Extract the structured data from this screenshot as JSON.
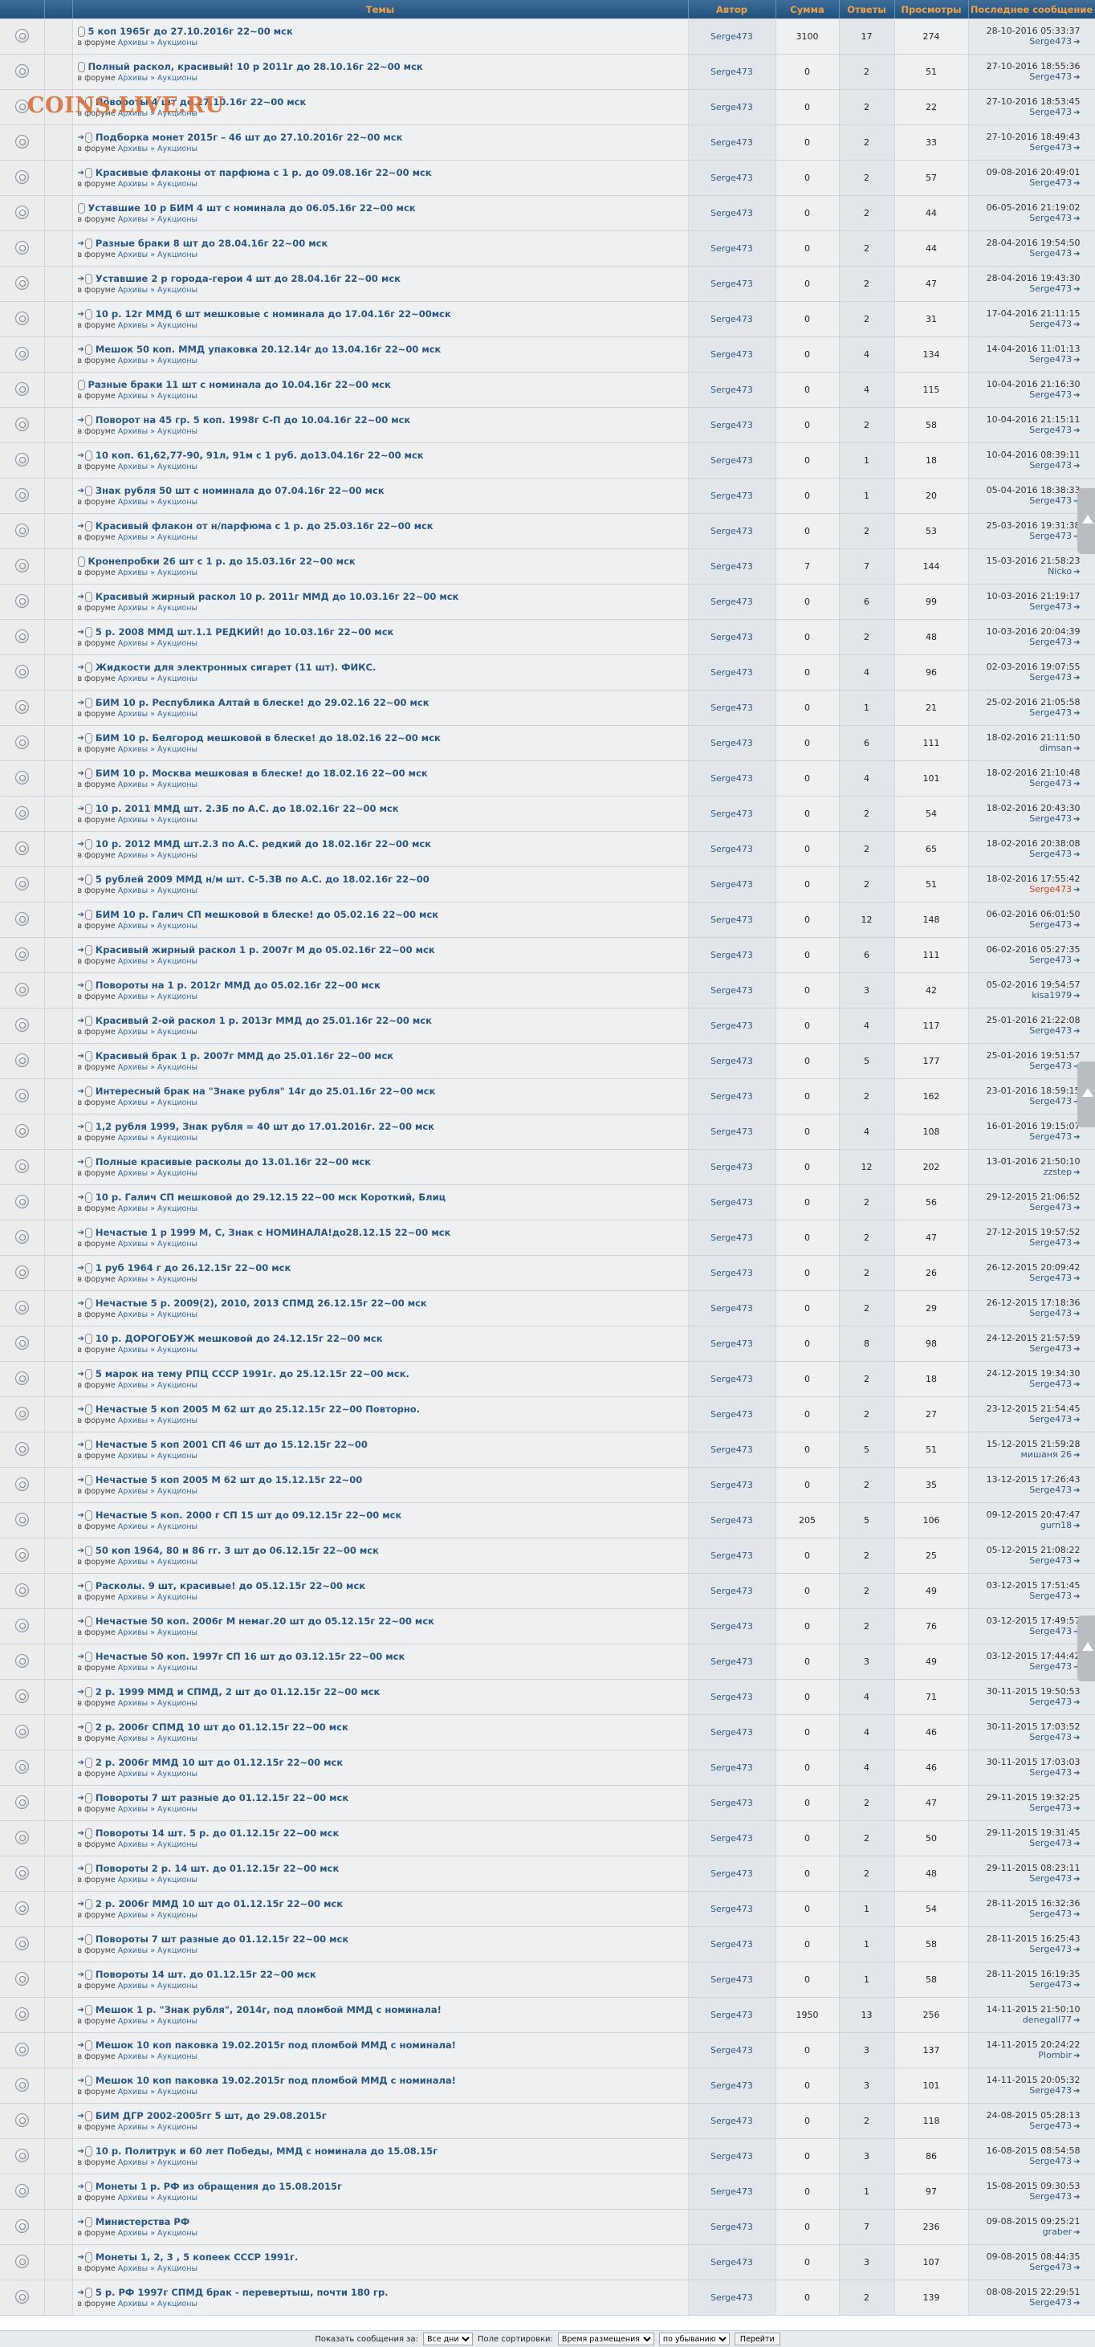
{
  "headers": {
    "topics": "Темы",
    "author": "Автор",
    "sum": "Сумма",
    "replies": "Ответы",
    "views": "Просмотры",
    "last": "Последнее сообщение"
  },
  "watermark": "COINS.LIVE.RU",
  "forum_prefix": "в форуме",
  "forum_link": "Архивы » Аукционы",
  "rows": [
    {
      "title": "5 коп 1965г до 27.10.2016г 22~00 мск",
      "author": "Serge473",
      "sum": "3100",
      "replies": "17",
      "views": "274",
      "date": "28-10-2016 05:33:37",
      "user": "Serge473",
      "newmark": false
    },
    {
      "title": "Полный раскол, красивый! 10 р 2011г до 28.10.16г 22~00 мск",
      "author": "Serge473",
      "sum": "0",
      "replies": "2",
      "views": "51",
      "date": "27-10-2016 18:55:36",
      "user": "Serge473",
      "newmark": false
    },
    {
      "title": "Повороты 4 шт до 27.10.16г 22~00 мск",
      "author": "Serge473",
      "sum": "0",
      "replies": "2",
      "views": "22",
      "date": "27-10-2016 18:53:45",
      "user": "Serge473",
      "newmark": true
    },
    {
      "title": "Подборка монет 2015г – 46 шт до 27.10.2016г 22~00 мск",
      "author": "Serge473",
      "sum": "0",
      "replies": "2",
      "views": "33",
      "date": "27-10-2016 18:49:43",
      "user": "Serge473",
      "newmark": true
    },
    {
      "title": "Красивые флаконы от парфюма с 1 р. до 09.08.16г 22~00 мск",
      "author": "Serge473",
      "sum": "0",
      "replies": "2",
      "views": "57",
      "date": "09-08-2016 20:49:01",
      "user": "Serge473",
      "newmark": true
    },
    {
      "title": "Уставшие 10 р БИМ 4 шт с номинала до 06.05.16г 22~00 мск",
      "author": "Serge473",
      "sum": "0",
      "replies": "2",
      "views": "44",
      "date": "06-05-2016 21:19:02",
      "user": "Serge473",
      "newmark": false
    },
    {
      "title": "Разные браки 8 шт до 28.04.16г 22~00 мск",
      "author": "Serge473",
      "sum": "0",
      "replies": "2",
      "views": "44",
      "date": "28-04-2016 19:54:50",
      "user": "Serge473",
      "newmark": true
    },
    {
      "title": "Уставшие 2 р города-герои 4 шт до 28.04.16г 22~00 мск",
      "author": "Serge473",
      "sum": "0",
      "replies": "2",
      "views": "47",
      "date": "28-04-2016 19:43:30",
      "user": "Serge473",
      "newmark": true
    },
    {
      "title": "10 р. 12г ММД 6 шт мешковые с номинала до 17.04.16г 22~00мск",
      "author": "Serge473",
      "sum": "0",
      "replies": "2",
      "views": "31",
      "date": "17-04-2016 21:11:15",
      "user": "Serge473",
      "newmark": true
    },
    {
      "title": "Мешок 50 коп. ММД упаковка 20.12.14г до 13.04.16г 22~00 мск",
      "author": "Serge473",
      "sum": "0",
      "replies": "4",
      "views": "134",
      "date": "14-04-2016 11:01:13",
      "user": "Serge473",
      "newmark": true
    },
    {
      "title": "Разные браки 11 шт с номинала до 10.04.16г 22~00 мск",
      "author": "Serge473",
      "sum": "0",
      "replies": "4",
      "views": "115",
      "date": "10-04-2016 21:16:30",
      "user": "Serge473",
      "newmark": false
    },
    {
      "title": "Поворот на 45 гр. 5 коп. 1998г С-П до 10.04.16г 22~00 мск",
      "author": "Serge473",
      "sum": "0",
      "replies": "2",
      "views": "58",
      "date": "10-04-2016 21:15:11",
      "user": "Serge473",
      "newmark": true
    },
    {
      "title": "10 коп. 61,62,77-90, 91л, 91м с 1 руб. до13.04.16г 22~00 мск",
      "author": "Serge473",
      "sum": "0",
      "replies": "1",
      "views": "18",
      "date": "10-04-2016 08:39:11",
      "user": "Serge473",
      "newmark": true
    },
    {
      "title": "Знак рубля 50 шт с номинала до 07.04.16г 22~00 мск",
      "author": "Serge473",
      "sum": "0",
      "replies": "1",
      "views": "20",
      "date": "05-04-2016 18:38:33",
      "user": "Serge473",
      "newmark": true
    },
    {
      "title": "Красивый флакон от н/парфюма с 1 р. до 25.03.16г 22~00 мск",
      "author": "Serge473",
      "sum": "0",
      "replies": "2",
      "views": "53",
      "date": "25-03-2016 19:31:38",
      "user": "Serge473",
      "newmark": true
    },
    {
      "title": "Кронепробки 26 шт с 1 р. до 15.03.16г 22~00 мск",
      "author": "Serge473",
      "sum": "7",
      "replies": "7",
      "views": "144",
      "date": "15-03-2016 21:58:23",
      "user": "Nicko",
      "newmark": false
    },
    {
      "title": "Красивый жирный раскол 10 р. 2011г ММД до 10.03.16г 22~00 мск",
      "author": "Serge473",
      "sum": "0",
      "replies": "6",
      "views": "99",
      "date": "10-03-2016 21:19:17",
      "user": "Serge473",
      "newmark": true
    },
    {
      "title": "5 р. 2008 ММД шт.1.1 РЕДКИЙ! до 10.03.16г 22~00 мск",
      "author": "Serge473",
      "sum": "0",
      "replies": "2",
      "views": "48",
      "date": "10-03-2016 20:04:39",
      "user": "Serge473",
      "newmark": true
    },
    {
      "title": "Жидкости для электронных сигарет (11 шт). ФИКС.",
      "author": "Serge473",
      "sum": "0",
      "replies": "4",
      "views": "96",
      "date": "02-03-2016 19:07:55",
      "user": "Serge473",
      "newmark": true
    },
    {
      "title": "БИМ 10 р. Республика Алтай в блеске! до 29.02.16 22~00 мск",
      "author": "Serge473",
      "sum": "0",
      "replies": "1",
      "views": "21",
      "date": "25-02-2016 21:05:58",
      "user": "Serge473",
      "newmark": true
    },
    {
      "title": "БИМ 10 р. Белгород мешковой в блеске! до 18.02.16 22~00 мск",
      "author": "Serge473",
      "sum": "0",
      "replies": "6",
      "views": "111",
      "date": "18-02-2016 21:11:50",
      "user": "dimsan",
      "newmark": true
    },
    {
      "title": "БИМ 10 р. Москва мешковая в блеске! до 18.02.16 22~00 мск",
      "author": "Serge473",
      "sum": "0",
      "replies": "4",
      "views": "101",
      "date": "18-02-2016 21:10:48",
      "user": "Serge473",
      "newmark": true
    },
    {
      "title": "10 р. 2011 ММД шт. 2.3Б по А.С. до 18.02.16г 22~00 мск",
      "author": "Serge473",
      "sum": "0",
      "replies": "2",
      "views": "54",
      "date": "18-02-2016 20:43:30",
      "user": "Serge473",
      "newmark": true
    },
    {
      "title": "10 р. 2012 ММД шт.2.3 по А.С. редкий до 18.02.16г 22~00 мск",
      "author": "Serge473",
      "sum": "0",
      "replies": "2",
      "views": "65",
      "date": "18-02-2016 20:38:08",
      "user": "Serge473",
      "newmark": true
    },
    {
      "title": "5 рублей 2009 ММД н/м шт. С-5.3В по А.С. до 18.02.16г 22~00",
      "author": "Serge473",
      "sum": "0",
      "replies": "2",
      "views": "51",
      "date": "18-02-2016 17:55:42",
      "user": "Serge473",
      "userRed": true,
      "newmark": true
    },
    {
      "title": "БИМ 10 р. Галич СП мешковой в блеске! до 05.02.16 22~00 мск",
      "author": "Serge473",
      "sum": "0",
      "replies": "12",
      "views": "148",
      "date": "06-02-2016 06:01:50",
      "user": "Serge473",
      "newmark": true
    },
    {
      "title": "Красивый жирный раскол 1 р. 2007г М до 05.02.16г 22~00 мск",
      "author": "Serge473",
      "sum": "0",
      "replies": "6",
      "views": "111",
      "date": "06-02-2016 05:27:35",
      "user": "Serge473",
      "newmark": true
    },
    {
      "title": "Повороты на 1 р. 2012г ММД до 05.02.16г 22~00 мск",
      "author": "Serge473",
      "sum": "0",
      "replies": "3",
      "views": "42",
      "date": "05-02-2016 19:54:57",
      "user": "kisa1979",
      "newmark": true
    },
    {
      "title": "Красивый 2-ой раскол 1 р. 2013г ММД до 25.01.16г 22~00 мск",
      "author": "Serge473",
      "sum": "0",
      "replies": "4",
      "views": "117",
      "date": "25-01-2016 21:22:08",
      "user": "Serge473",
      "newmark": true
    },
    {
      "title": "Красивый брак 1 р. 2007г ММД до 25.01.16г 22~00 мск",
      "author": "Serge473",
      "sum": "0",
      "replies": "5",
      "views": "177",
      "date": "25-01-2016 19:51:57",
      "user": "Serge473",
      "newmark": true
    },
    {
      "title": "Интересный брак на \"Знаке рубля\" 14г до 25.01.16г 22~00 мск",
      "author": "Serge473",
      "sum": "0",
      "replies": "2",
      "views": "162",
      "date": "23-01-2016 18:59:15",
      "user": "Serge473",
      "newmark": true
    },
    {
      "title": "1,2 рубля 1999, Знак рубля = 40 шт до 17.01.2016г. 22~00 мск",
      "author": "Serge473",
      "sum": "0",
      "replies": "4",
      "views": "108",
      "date": "16-01-2016 19:15:07",
      "user": "Serge473",
      "newmark": true
    },
    {
      "title": "Полные красивые расколы до 13.01.16г 22~00 мск",
      "author": "Serge473",
      "sum": "0",
      "replies": "12",
      "views": "202",
      "date": "13-01-2016 21:50:10",
      "user": "zzstep",
      "newmark": true
    },
    {
      "title": "10 р. Галич СП мешковой до 29.12.15 22~00 мск Короткий, Блиц",
      "author": "Serge473",
      "sum": "0",
      "replies": "2",
      "views": "56",
      "date": "29-12-2015 21:06:52",
      "user": "Serge473",
      "newmark": true
    },
    {
      "title": "Нечастые 1 р 1999 М, С, Знак с НОМИНАЛА!до28.12.15 22~00 мск",
      "author": "Serge473",
      "sum": "0",
      "replies": "2",
      "views": "47",
      "date": "27-12-2015 19:57:52",
      "user": "Serge473",
      "newmark": true
    },
    {
      "title": "1 руб 1964 г до 26.12.15г 22~00 мск",
      "author": "Serge473",
      "sum": "0",
      "replies": "2",
      "views": "26",
      "date": "26-12-2015 20:09:42",
      "user": "Serge473",
      "newmark": true
    },
    {
      "title": "Нечастые 5 р. 2009(2), 2010, 2013 СПМД 26.12.15г 22~00 мск",
      "author": "Serge473",
      "sum": "0",
      "replies": "2",
      "views": "29",
      "date": "26-12-2015 17:18:36",
      "user": "Serge473",
      "newmark": true
    },
    {
      "title": "10 р. ДОРОГОБУЖ мешковой до 24.12.15г 22~00 мск",
      "author": "Serge473",
      "sum": "0",
      "replies": "8",
      "views": "98",
      "date": "24-12-2015 21:57:59",
      "user": "Serge473",
      "newmark": true
    },
    {
      "title": "5 марок на тему РПЦ СССР 1991г. до 25.12.15г 22~00 мск.",
      "author": "Serge473",
      "sum": "0",
      "replies": "2",
      "views": "18",
      "date": "24-12-2015 19:34:30",
      "user": "Serge473",
      "newmark": true
    },
    {
      "title": "Нечастые 5 коп 2005 М 62 шт до 25.12.15г 22~00 Повторно.",
      "author": "Serge473",
      "sum": "0",
      "replies": "2",
      "views": "27",
      "date": "23-12-2015 21:54:45",
      "user": "Serge473",
      "newmark": true
    },
    {
      "title": "Нечастые 5 коп 2001 СП 46 шт до 15.12.15г 22~00",
      "author": "Serge473",
      "sum": "0",
      "replies": "5",
      "views": "51",
      "date": "15-12-2015 21:59:28",
      "user": "мишаня 26",
      "newmark": true
    },
    {
      "title": "Нечастые 5 коп 2005 М 62 шт до 15.12.15г 22~00",
      "author": "Serge473",
      "sum": "0",
      "replies": "2",
      "views": "35",
      "date": "13-12-2015 17:26:43",
      "user": "Serge473",
      "newmark": true
    },
    {
      "title": "Нечастые 5 коп. 2000 г СП 15 шт до 09.12.15г 22~00 мск",
      "author": "Serge473",
      "sum": "205",
      "replies": "5",
      "views": "106",
      "date": "09-12-2015 20:47:47",
      "user": "gurn18",
      "newmark": true
    },
    {
      "title": "50 коп 1964, 80 и 86 гг. 3 шт до 06.12.15г 22~00 мск",
      "author": "Serge473",
      "sum": "0",
      "replies": "2",
      "views": "25",
      "date": "05-12-2015 21:08:22",
      "user": "Serge473",
      "newmark": true
    },
    {
      "title": "Расколы. 9 шт, красивые! до 05.12.15г 22~00 мск",
      "author": "Serge473",
      "sum": "0",
      "replies": "2",
      "views": "49",
      "date": "03-12-2015 17:51:45",
      "user": "Serge473",
      "newmark": true
    },
    {
      "title": "Нечастые 50 коп. 2006г М немаг.20 шт до 05.12.15г 22~00 мск",
      "author": "Serge473",
      "sum": "0",
      "replies": "2",
      "views": "76",
      "date": "03-12-2015 17:49:57",
      "user": "Serge473",
      "newmark": true
    },
    {
      "title": "Нечастые 50 коп. 1997г СП 16 шт до 03.12.15г 22~00 мск",
      "author": "Serge473",
      "sum": "0",
      "replies": "3",
      "views": "49",
      "date": "03-12-2015 17:44:42",
      "user": "Serge473",
      "newmark": true
    },
    {
      "title": "2 р. 1999 ММД и СПМД, 2 шт до 01.12.15г 22~00 мск",
      "author": "Serge473",
      "sum": "0",
      "replies": "4",
      "views": "71",
      "date": "30-11-2015 19:50:53",
      "user": "Serge473",
      "newmark": true
    },
    {
      "title": "2 р. 2006г СПМД 10 шт до 01.12.15г 22~00 мск",
      "author": "Serge473",
      "sum": "0",
      "replies": "4",
      "views": "46",
      "date": "30-11-2015 17:03:52",
      "user": "Serge473",
      "newmark": true
    },
    {
      "title": "2 р. 2006г ММД 10 шт до 01.12.15г 22~00 мск",
      "author": "Serge473",
      "sum": "0",
      "replies": "4",
      "views": "46",
      "date": "30-11-2015 17:03:03",
      "user": "Serge473",
      "newmark": true
    },
    {
      "title": "Повороты 7 шт разные до 01.12.15г 22~00 мск",
      "author": "Serge473",
      "sum": "0",
      "replies": "2",
      "views": "47",
      "date": "29-11-2015 19:32:25",
      "user": "Serge473",
      "newmark": true
    },
    {
      "title": "Повороты 14 шт. 5 р. до 01.12.15г 22~00 мск",
      "author": "Serge473",
      "sum": "0",
      "replies": "2",
      "views": "50",
      "date": "29-11-2015 19:31:45",
      "user": "Serge473",
      "newmark": true
    },
    {
      "title": "Повороты 2 р. 14 шт. до 01.12.15г 22~00 мск",
      "author": "Serge473",
      "sum": "0",
      "replies": "2",
      "views": "48",
      "date": "29-11-2015 08:23:11",
      "user": "Serge473",
      "newmark": true
    },
    {
      "title": "2 р. 2006г ММД 10 шт до 01.12.15г 22~00 мск",
      "author": "Serge473",
      "sum": "0",
      "replies": "1",
      "views": "54",
      "date": "28-11-2015 16:32:36",
      "user": "Serge473",
      "newmark": true
    },
    {
      "title": "Повороты 7 шт разные до 01.12.15г 22~00 мск",
      "author": "Serge473",
      "sum": "0",
      "replies": "1",
      "views": "58",
      "date": "28-11-2015 16:25:43",
      "user": "Serge473",
      "newmark": true
    },
    {
      "title": "Повороты 14 шт. до 01.12.15г 22~00 мск",
      "author": "Serge473",
      "sum": "0",
      "replies": "1",
      "views": "58",
      "date": "28-11-2015 16:19:35",
      "user": "Serge473",
      "newmark": true
    },
    {
      "title": "Мешок 1 р. \"Знак рубля\", 2014г, под пломбой ММД с номинала!",
      "author": "Serge473",
      "sum": "1950",
      "replies": "13",
      "views": "256",
      "date": "14-11-2015 21:50:10",
      "user": "denegall77",
      "newmark": true
    },
    {
      "title": "Мешок 10 коп паковка 19.02.2015г под пломбой ММД с номинала!",
      "author": "Serge473",
      "sum": "0",
      "replies": "3",
      "views": "137",
      "date": "14-11-2015 20:24:22",
      "user": "Plombir",
      "newmark": true
    },
    {
      "title": "Мешок 10 коп паковка 19.02.2015г под пломбой ММД с номинала!",
      "author": "Serge473",
      "sum": "0",
      "replies": "3",
      "views": "101",
      "date": "14-11-2015 20:05:32",
      "user": "Serge473",
      "newmark": true
    },
    {
      "title": "БИМ ДГР 2002-2005гг 5 шт, до 29.08.2015г",
      "author": "Serge473",
      "sum": "0",
      "replies": "2",
      "views": "118",
      "date": "24-08-2015 05:28:13",
      "user": "Serge473",
      "newmark": true
    },
    {
      "title": "10 р. Политрук и 60 лет Победы, ММД с номинала до 15.08.15г",
      "author": "Serge473",
      "sum": "0",
      "replies": "3",
      "views": "86",
      "date": "16-08-2015 08:54:58",
      "user": "Serge473",
      "newmark": true
    },
    {
      "title": "Монеты 1 р. РФ из обращения до 15.08.2015г",
      "author": "Serge473",
      "sum": "0",
      "replies": "1",
      "views": "97",
      "date": "15-08-2015 09:30:53",
      "user": "Serge473",
      "newmark": true
    },
    {
      "title": "Министерства РФ",
      "author": "Serge473",
      "sum": "0",
      "replies": "7",
      "views": "236",
      "date": "09-08-2015 09:25:21",
      "user": "graber",
      "newmark": true
    },
    {
      "title": "Монеты 1, 2, 3 , 5 копеек СССР 1991г.",
      "author": "Serge473",
      "sum": "0",
      "replies": "3",
      "views": "107",
      "date": "09-08-2015 08:44:35",
      "user": "Serge473",
      "newmark": true
    },
    {
      "title": "5 р. РФ 1997г СПМД брак - перевертыш, почти 180 гр.",
      "author": "Serge473",
      "sum": "0",
      "replies": "2",
      "views": "139",
      "date": "08-08-2015 22:29:51",
      "user": "Serge473",
      "newmark": true
    }
  ],
  "bottom": {
    "show_label": "Показать сообщения за:",
    "show_value": "Все дни",
    "sort_label": "Поле сортировки:",
    "sort_value": "Время размещения",
    "order_value": "по убыванию",
    "go_button": "Перейти"
  }
}
